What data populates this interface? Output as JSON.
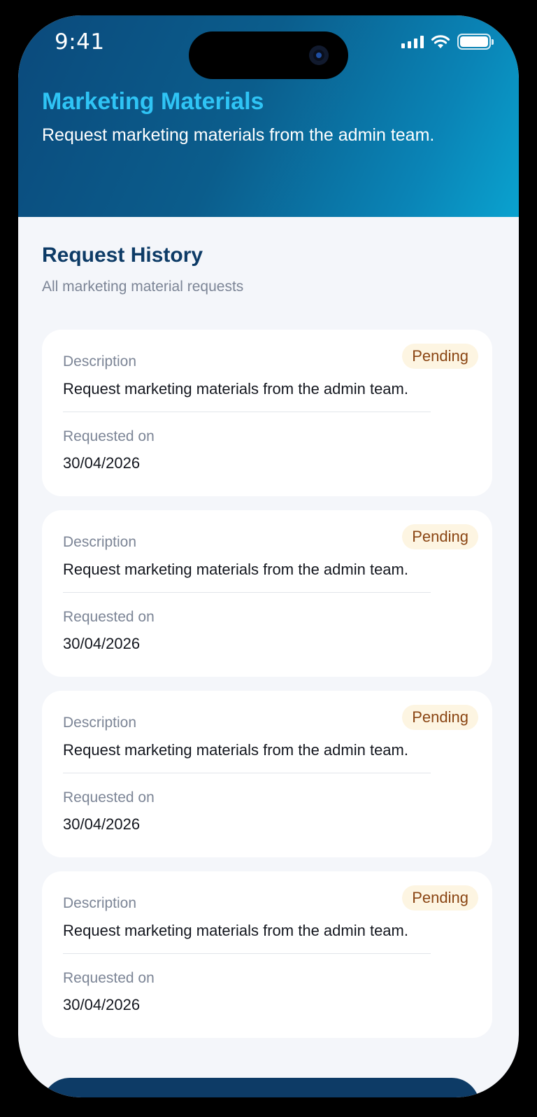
{
  "status_bar": {
    "time": "9:41",
    "icons": [
      "signal-icon",
      "wifi-icon",
      "battery-icon"
    ]
  },
  "header": {
    "title": "Marketing Materials",
    "subtitle": "Request marketing materials from the admin team."
  },
  "section": {
    "title": "Request History",
    "subtitle": "All marketing material requests"
  },
  "requests": [
    {
      "description_label": "Description",
      "description": "Request marketing materials from the admin team.",
      "date_label": "Requested on",
      "date": "30/04/2026",
      "status": "Pending"
    },
    {
      "description_label": "Description",
      "description": "Request marketing materials from the admin team.",
      "date_label": "Requested on",
      "date": "30/04/2026",
      "status": "Pending"
    },
    {
      "description_label": "Description",
      "description": "Request marketing materials from the admin team.",
      "date_label": "Requested on",
      "date": "30/04/2026",
      "status": "Pending"
    },
    {
      "description_label": "Description",
      "description": "Request marketing materials from the admin team.",
      "date_label": "Requested on",
      "date": "30/04/2026",
      "status": "Pending"
    }
  ],
  "colors": {
    "title_accent": "#2fc4f5",
    "section_title": "#0d3b66",
    "badge_bg": "#fdf5e2",
    "badge_text": "#8a4513",
    "page_bg": "#f4f6fa"
  }
}
